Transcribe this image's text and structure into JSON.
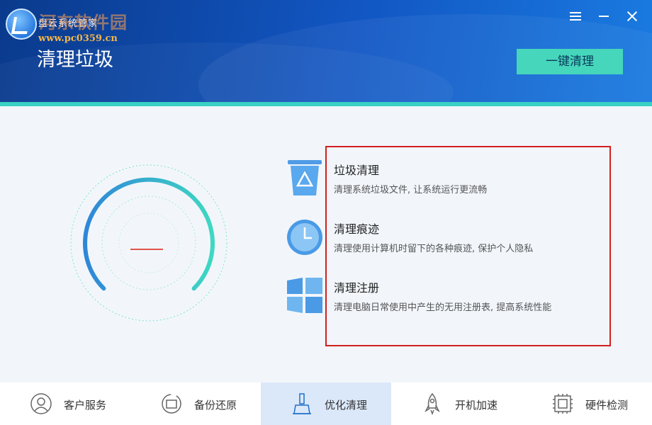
{
  "header": {
    "app_title": "盘云系统管家",
    "watermark_text": "河东软件园",
    "watermark_url": "www.pc0359.cn",
    "page_title": "清理垃圾",
    "action_button_label": "一键清理",
    "accent_color": "#45d6bb",
    "band_color": "#39d0c4"
  },
  "gauge": {
    "value_text": "—"
  },
  "features": [
    {
      "title": "垃圾清理",
      "desc": "清理系统垃圾文件, 让系统运行更流畅",
      "icon": "trash-icon"
    },
    {
      "title": "清理痕迹",
      "desc": "清理使用计算机时留下的各种痕迹, 保护个人隐私",
      "icon": "clock-icon"
    },
    {
      "title": "清理注册",
      "desc": "清理电脑日常使用中产生的无用注册表, 提高系统性能",
      "icon": "windows-icon"
    }
  ],
  "nav": [
    {
      "label": "客户服务",
      "icon": "user-icon",
      "active": false
    },
    {
      "label": "备份还原",
      "icon": "backup-icon",
      "active": false
    },
    {
      "label": "优化清理",
      "icon": "broom-icon",
      "active": true
    },
    {
      "label": "开机加速",
      "icon": "rocket-icon",
      "active": false
    },
    {
      "label": "硬件检测",
      "icon": "chip-icon",
      "active": false
    }
  ]
}
